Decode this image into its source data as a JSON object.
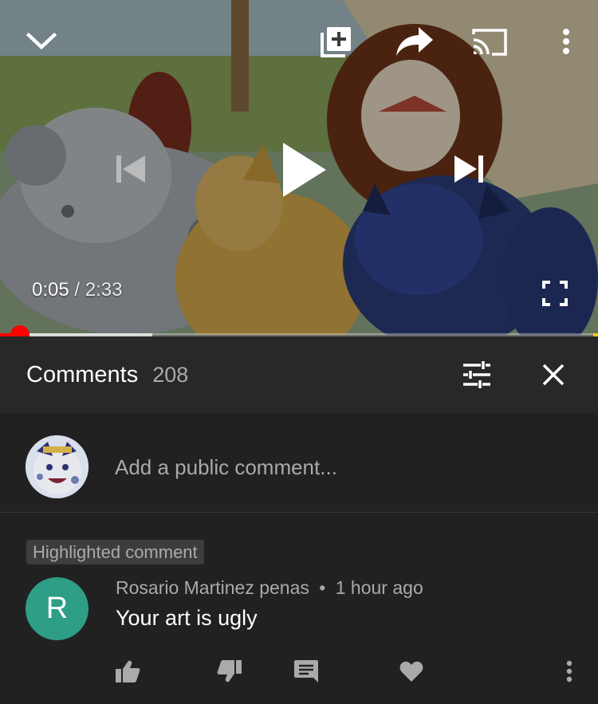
{
  "player": {
    "current_time": "0:05",
    "separator": "/",
    "duration": "2:33",
    "progress_fraction": 0.033,
    "buffered_fraction": 0.255,
    "accent": "#ff0000"
  },
  "player_icons": {
    "collapse": "chevron-down-icon",
    "add_to_playlist": "playlist-add-icon",
    "share": "share-icon",
    "cast": "cast-icon",
    "more": "more-vertical-icon",
    "previous": "skip-previous-icon",
    "play": "play-icon",
    "next": "skip-next-icon",
    "fullscreen": "fullscreen-icon"
  },
  "comments": {
    "title": "Comments",
    "count": "208",
    "add_placeholder": "Add a public comment...",
    "highlighted_label": "Highlighted comment"
  },
  "comment": {
    "avatar_letter": "R",
    "avatar_color": "#2e9e86",
    "author": "Rosario Martinez penas",
    "dot": "•",
    "time": "1 hour ago",
    "text": "Your art is ugly"
  }
}
